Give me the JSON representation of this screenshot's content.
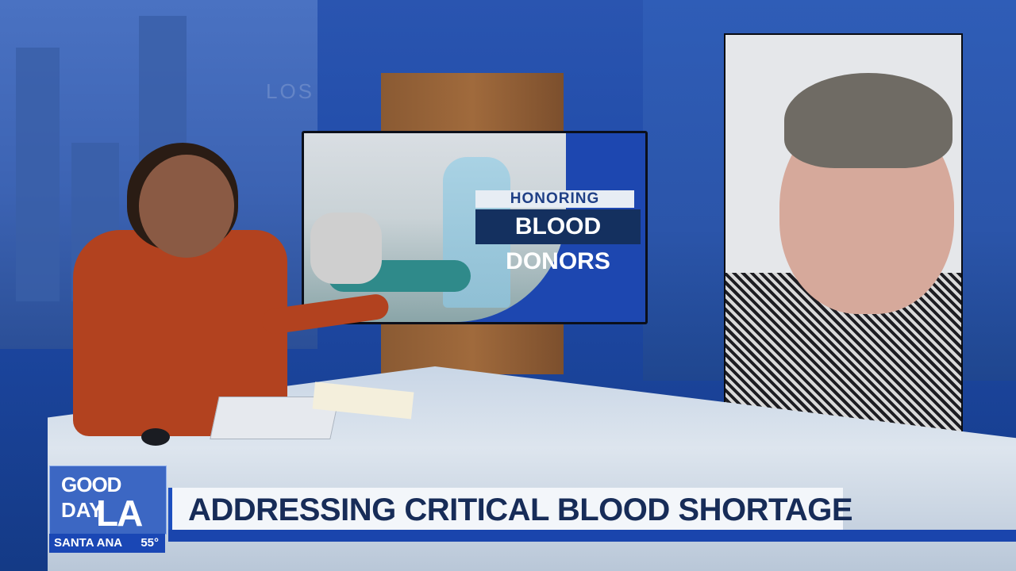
{
  "scene": {
    "tv_graphic": {
      "line1": "HONORING",
      "line2": "BLOOD DONORS"
    },
    "background_text": "LOS"
  },
  "lower_third": {
    "logo": {
      "line1": "GOOD",
      "line2": "DAY",
      "line3": "LA"
    },
    "weather": {
      "city": "SANTA ANA",
      "temperature": "55°"
    },
    "headline": "ADDRESSING CRITICAL BLOOD SHORTAGE"
  },
  "colors": {
    "brand_blue": "#1a45ad",
    "headline_text": "#172c58",
    "anchor_sweater": "#b2421f"
  }
}
